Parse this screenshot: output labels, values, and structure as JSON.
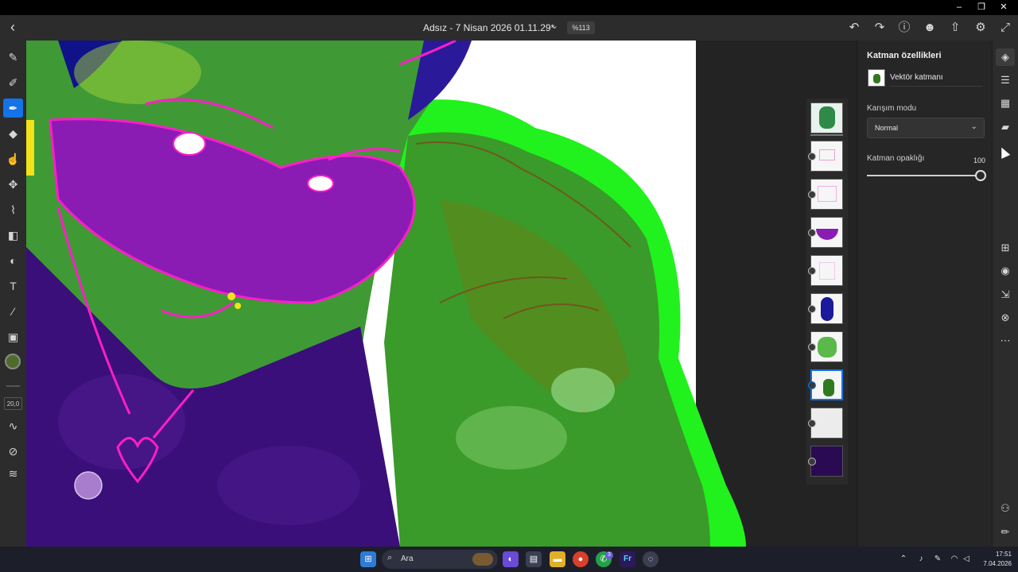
{
  "window": {
    "minimize_icon": "minimize-icon",
    "restore_icon": "restore-icon",
    "close_icon": "close-icon"
  },
  "header": {
    "title": "Adsız - 7 Nisan 2026 01.11.29*",
    "zoom": "%113",
    "icons": [
      "back-icon",
      "undo-icon",
      "redo-icon",
      "help-icon",
      "invite-icon",
      "share-icon",
      "settings-icon",
      "fullscreen-icon"
    ]
  },
  "tools": {
    "icons": [
      "pixel-brush-icon",
      "live-brush-icon",
      "vector-brush-icon",
      "eraser-icon",
      "smudge-icon",
      "move-icon",
      "lasso-icon",
      "fill-icon",
      "shape-icon",
      "text-icon",
      "eyedropper-icon",
      "place-image-icon"
    ],
    "active": "vector-brush-icon",
    "current_color": "#4e6b2b",
    "brush_size": "20,0"
  },
  "layers": {
    "count": 10,
    "selected_index": 7
  },
  "properties": {
    "title": "Katman özellikleri",
    "layer_type": "Vektör katmanı",
    "blend_label": "Karışım modu",
    "blend_value": "Normal",
    "opacity_label": "Katman opaklığı",
    "opacity_value": "100",
    "opacity_fraction": 1.0
  },
  "rail": {
    "icons": [
      "layers-icon",
      "properties-icon",
      "grid-icon",
      "comments-icon",
      "add-layer-icon",
      "visibility-icon",
      "export-icon",
      "mask-icon",
      "more-icon",
      "assets-icon",
      "draw-icon"
    ]
  },
  "taskbar": {
    "search_label": "Ara",
    "whatsapp_badge": "3",
    "time": "17:51",
    "date": "7.04.2026",
    "accent": "#1473e6"
  }
}
